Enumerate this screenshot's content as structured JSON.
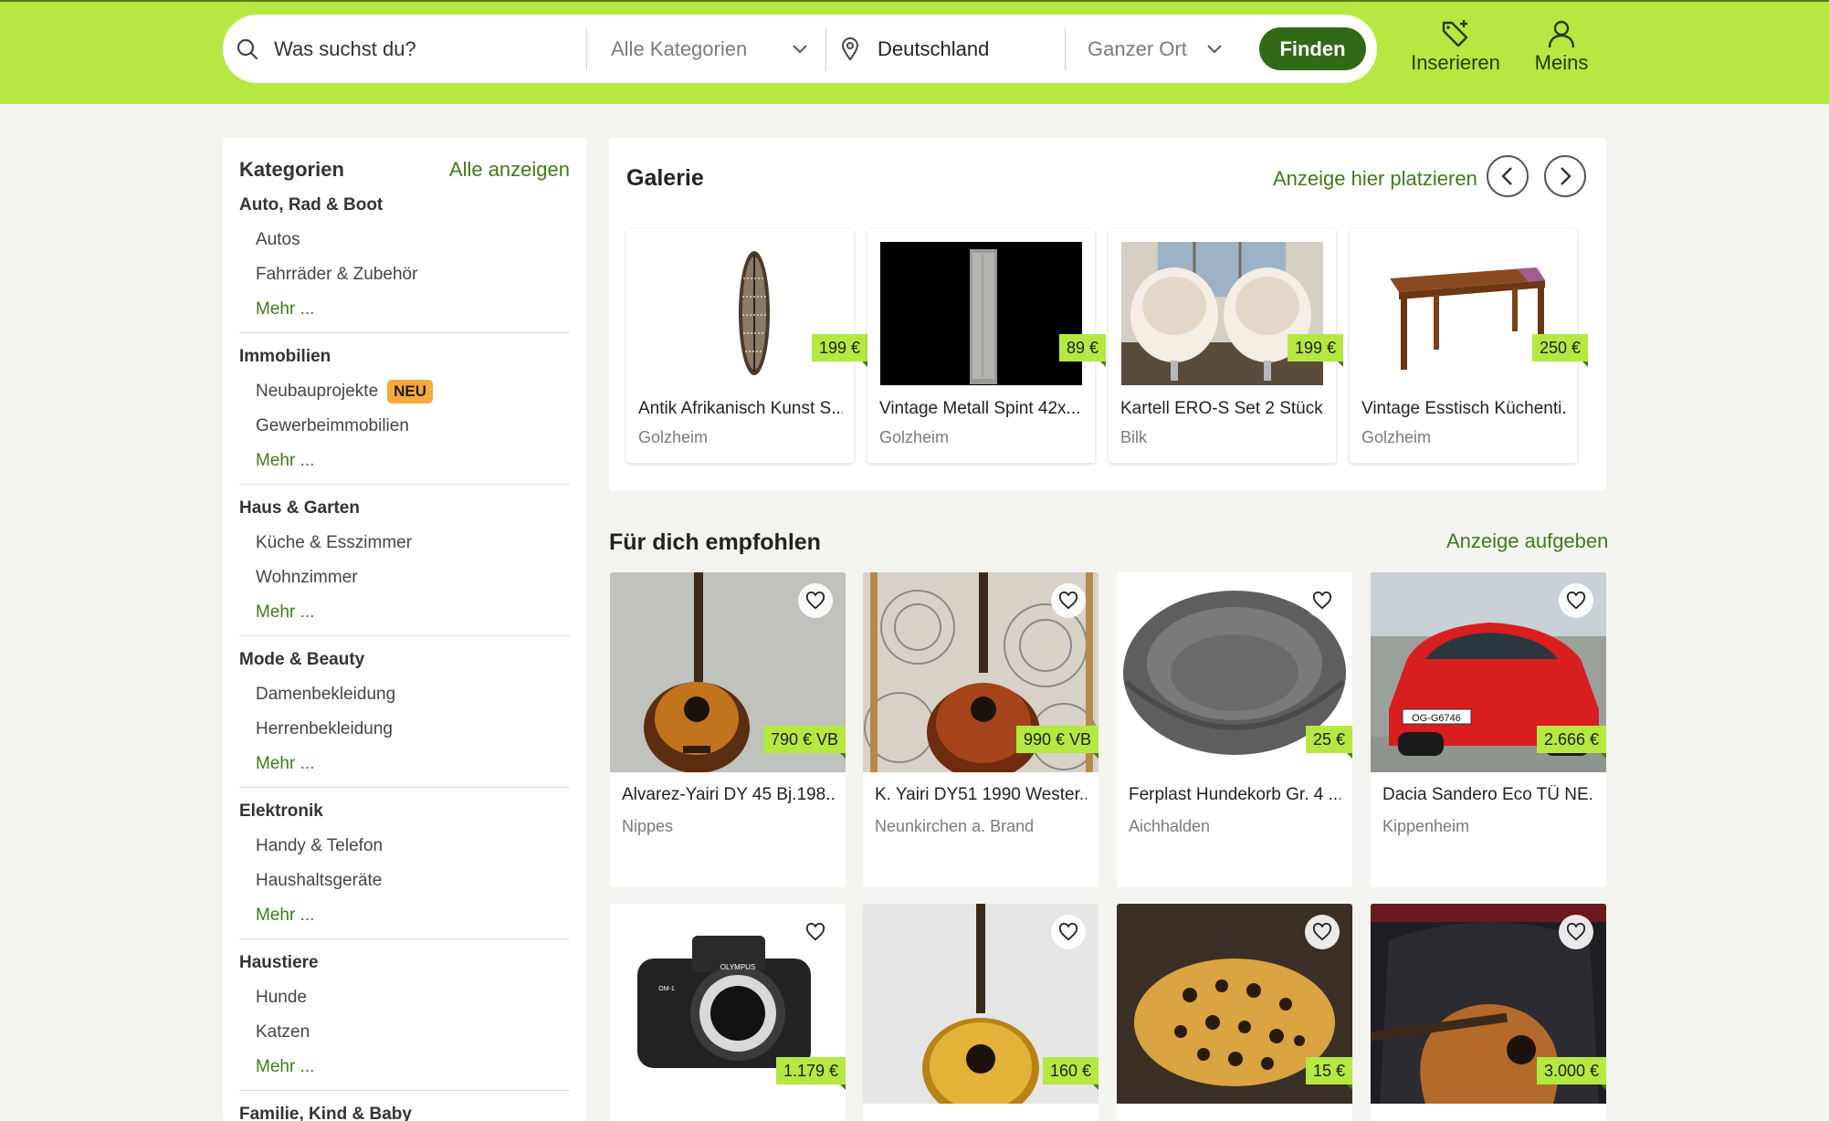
{
  "header": {
    "search_placeholder": "Was suchst du?",
    "category_select": "Alle Kategorien",
    "location_value": "Deutschland",
    "radius_select": "Ganzer Ort",
    "search_button": "Finden",
    "nav_post": "Inserieren",
    "nav_mine": "Meins"
  },
  "sidebar": {
    "heading": "Kategorien",
    "show_all": "Alle anzeigen",
    "more_label": "Mehr ...",
    "categories": [
      {
        "title": "Auto, Rad & Boot",
        "subs": [
          "Autos",
          "Fahrräder & Zubehör"
        ]
      },
      {
        "title": "Immobilien",
        "subs": [
          "Neubauprojekte",
          "Gewerbeimmobilien"
        ],
        "badge": "NEU"
      },
      {
        "title": "Haus & Garten",
        "subs": [
          "Küche & Esszimmer",
          "Wohnzimmer"
        ]
      },
      {
        "title": "Mode & Beauty",
        "subs": [
          "Damenbekleidung",
          "Herrenbekleidung"
        ]
      },
      {
        "title": "Elektronik",
        "subs": [
          "Handy & Telefon",
          "Haushaltsgeräte"
        ]
      },
      {
        "title": "Haustiere",
        "subs": [
          "Hunde",
          "Katzen"
        ]
      },
      {
        "title": "Familie, Kind & Baby"
      }
    ]
  },
  "gallery": {
    "title": "Galerie",
    "cta": "Anzeige hier platzieren",
    "items": [
      {
        "title": "Antik Afrikanisch Kunst S...",
        "location": "Golzheim",
        "price": "199 €"
      },
      {
        "title": "Vintage Metall Spint 42x...",
        "location": "Golzheim",
        "price": "89 €"
      },
      {
        "title": "Kartell ERO-S Set 2 Stück",
        "location": "Bilk",
        "price": "199 €"
      },
      {
        "title": "Vintage Esstisch Küchenti...",
        "location": "Golzheim",
        "price": "250 €"
      }
    ]
  },
  "recommended": {
    "title": "Für dich empfohlen",
    "cta": "Anzeige aufgeben",
    "items": [
      {
        "title": "Alvarez-Yairi DY 45 Bj.198...",
        "location": "Nippes",
        "price": "790 € VB"
      },
      {
        "title": "K. Yairi DY51 1990 Wester...",
        "location": "Neunkirchen a. Brand",
        "price": "990 € VB"
      },
      {
        "title": "Ferplast Hundekorb Gr. 4 ...",
        "location": "Aichhalden",
        "price": "25 €"
      },
      {
        "title": "Dacia Sandero Eco TÜ NE...",
        "location": "Kippenheim",
        "price": "2.666 €",
        "plate": "OG-G6746"
      },
      {
        "price": "1.179 €",
        "brand_mark": "OLYMPUS",
        "model_mark": "OM-1"
      },
      {
        "price": "160 €"
      },
      {
        "price": "15 €"
      },
      {
        "price": "3.000 €"
      }
    ]
  },
  "colors": {
    "brand_green": "#b5e941",
    "dark_green": "#326916",
    "link_green": "#3e7b17",
    "badge_orange": "#f7a93b"
  }
}
